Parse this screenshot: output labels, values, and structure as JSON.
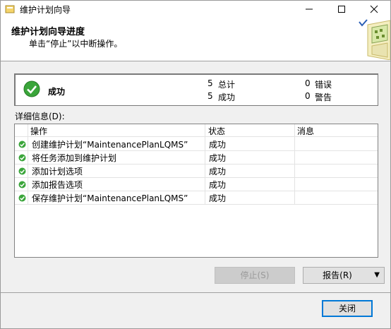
{
  "window": {
    "title": "维护计划向导"
  },
  "header": {
    "title": "维护计划向导进度",
    "subtitle": "单击“停止”以中断操作。"
  },
  "summary": {
    "status": "成功",
    "total_count": "5",
    "total_label": "总计",
    "success_count": "5",
    "success_label": "成功",
    "error_count": "0",
    "error_label": "错误",
    "warning_count": "0",
    "warning_label": "警告"
  },
  "details_label": "详细信息(D):",
  "grid": {
    "columns": [
      "操作",
      "状态",
      "消息"
    ],
    "rows": [
      {
        "operation": "创建维护计划“MaintenancePlanLQMS”",
        "status": "成功",
        "message": ""
      },
      {
        "operation": "将任务添加到维护计划",
        "status": "成功",
        "message": ""
      },
      {
        "operation": "添加计划选项",
        "status": "成功",
        "message": ""
      },
      {
        "operation": "添加报告选项",
        "status": "成功",
        "message": ""
      },
      {
        "operation": "保存维护计划“MaintenancePlanLQMS”",
        "status": "成功",
        "message": ""
      }
    ]
  },
  "buttons": {
    "stop": "停止(S)",
    "report": "报告(R)",
    "close": "关闭"
  },
  "colors": {
    "success_green": "#3aa53a",
    "focus_blue": "#0078d7"
  }
}
